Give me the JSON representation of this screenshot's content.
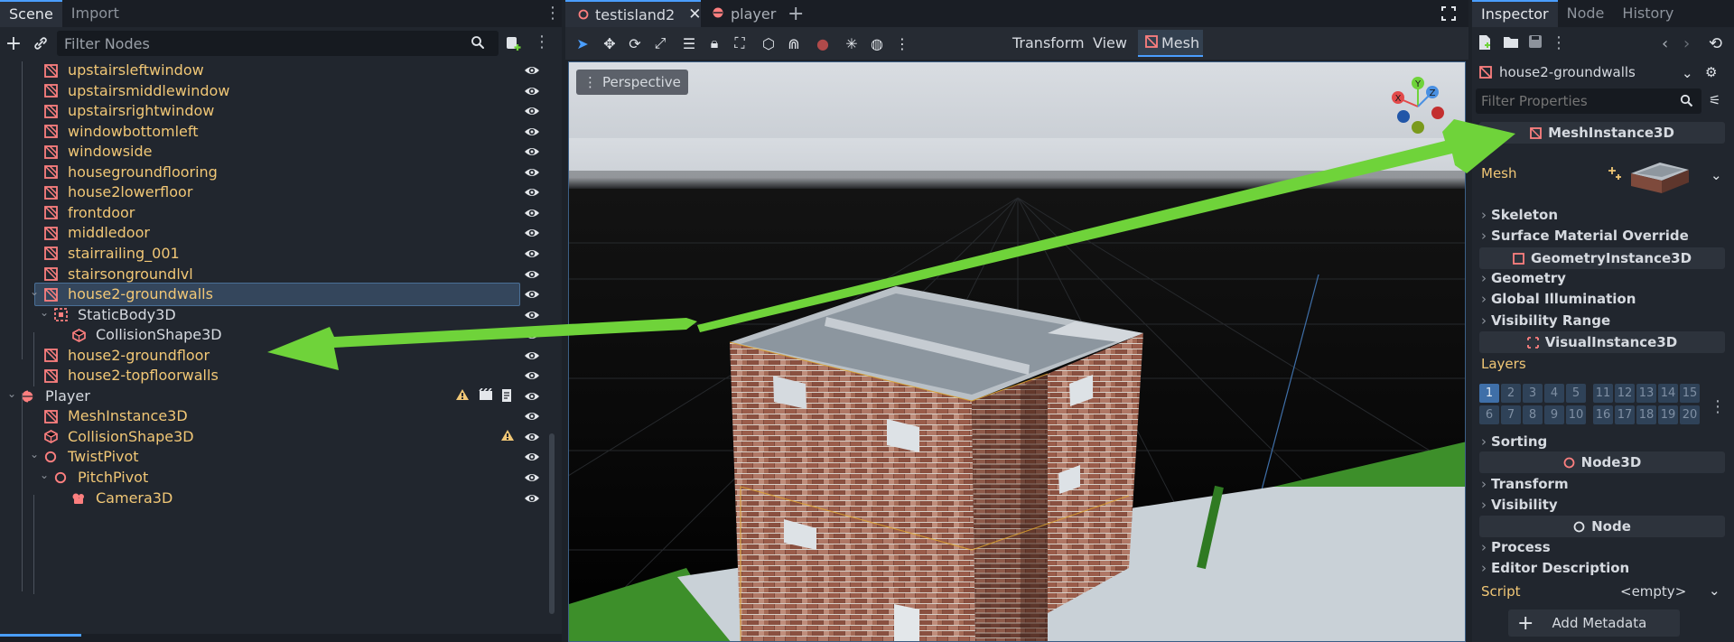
{
  "scene_dock": {
    "tabs": [
      "Scene",
      "Import"
    ],
    "filter_placeholder": "Filter Nodes",
    "nodes": [
      {
        "label": "upstairsleftwindow",
        "color": "yellow",
        "icon": "mesh-instance-icon",
        "indent": 1
      },
      {
        "label": "upstairsmiddlewindow",
        "color": "yellow",
        "icon": "mesh-instance-icon",
        "indent": 1
      },
      {
        "label": "upstairsrightwindow",
        "color": "yellow",
        "icon": "mesh-instance-icon",
        "indent": 1
      },
      {
        "label": "windowbottomleft",
        "color": "yellow",
        "icon": "mesh-instance-icon",
        "indent": 1
      },
      {
        "label": "windowside",
        "color": "yellow",
        "icon": "mesh-instance-icon",
        "indent": 1
      },
      {
        "label": "housegroundflooring",
        "color": "yellow",
        "icon": "mesh-instance-icon",
        "indent": 1
      },
      {
        "label": "house2lowerfloor",
        "color": "yellow",
        "icon": "mesh-instance-icon",
        "indent": 1
      },
      {
        "label": "frontdoor",
        "color": "yellow",
        "icon": "mesh-instance-icon",
        "indent": 1
      },
      {
        "label": "middledoor",
        "color": "yellow",
        "icon": "mesh-instance-icon",
        "indent": 1
      },
      {
        "label": "stairrailing_001",
        "color": "yellow",
        "icon": "mesh-instance-icon",
        "indent": 1
      },
      {
        "label": "stairsongroundlvl",
        "color": "yellow",
        "icon": "mesh-instance-icon",
        "indent": 1
      },
      {
        "label": "house2-groundwalls",
        "color": "yellow",
        "icon": "mesh-instance-icon",
        "indent": 1,
        "selected": true,
        "expanded": true
      },
      {
        "label": "StaticBody3D",
        "color": "white",
        "icon": "static-body-icon",
        "indent": 2,
        "expanded": true
      },
      {
        "label": "CollisionShape3D",
        "color": "white",
        "icon": "collision-shape-icon",
        "indent": 3
      },
      {
        "label": "house2-groundfloor",
        "color": "yellow",
        "icon": "mesh-instance-icon",
        "indent": 1
      },
      {
        "label": "house2-topfloorwalls",
        "color": "yellow",
        "icon": "mesh-instance-icon",
        "indent": 1
      },
      {
        "label": "Player",
        "color": "white",
        "icon": "player-scene-icon",
        "indent": 0,
        "expanded": true,
        "badges": true
      },
      {
        "label": "MeshInstance3D",
        "color": "yellow",
        "icon": "mesh-instance-icon",
        "indent": 1
      },
      {
        "label": "CollisionShape3D",
        "color": "yellow",
        "icon": "collision-shape-icon",
        "indent": 1,
        "warning": true
      },
      {
        "label": "TwistPivot",
        "color": "yellow",
        "icon": "node3d-icon",
        "indent": 1,
        "expanded": true
      },
      {
        "label": "PitchPivot",
        "color": "yellow",
        "icon": "node3d-icon",
        "indent": 2,
        "expanded": true
      },
      {
        "label": "Camera3D",
        "color": "yellow",
        "icon": "camera-icon",
        "indent": 3
      }
    ]
  },
  "editor": {
    "tabs": [
      {
        "label": "testisland2",
        "active": true
      },
      {
        "label": "player",
        "active": false
      }
    ],
    "toolbar": {
      "transform_label": "Transform",
      "view_label": "View",
      "mesh_label": "Mesh"
    },
    "viewport": {
      "perspective_label": "Perspective",
      "gizmo_axes": [
        "X",
        "Y",
        "Z"
      ]
    }
  },
  "inspector": {
    "tabs": [
      "Inspector",
      "Node",
      "History"
    ],
    "selected_node": "house2-groundwalls",
    "filter_placeholder": "Filter Properties",
    "class_mesh_instance": "MeshInstance3D",
    "mesh_label": "Mesh",
    "sections_a": [
      "Skeleton",
      "Surface Material Override"
    ],
    "class_geometry_instance": "GeometryInstance3D",
    "sections_b": [
      "Geometry",
      "Global Illumination",
      "Visibility Range"
    ],
    "class_visual_instance": "VisualInstance3D",
    "layers_label": "Layers",
    "layers_row1": [
      "1",
      "2",
      "3",
      "4",
      "5",
      "11",
      "12",
      "13",
      "14",
      "15"
    ],
    "layers_row2": [
      "6",
      "7",
      "8",
      "9",
      "10",
      "16",
      "17",
      "18",
      "19",
      "20"
    ],
    "sorting_label": "Sorting",
    "class_node3d": "Node3D",
    "sections_c": [
      "Transform",
      "Visibility"
    ],
    "class_node": "Node",
    "sections_d": [
      "Process",
      "Editor Description"
    ],
    "script_label": "Script",
    "script_value": "<empty>",
    "add_metadata_label": "Add Metadata"
  },
  "colors": {
    "accent": "#4a9eff",
    "node_yellow": "#f1c776",
    "mesh_red": "#fc7f7f",
    "annotation_arrow": "#6fd33a"
  }
}
